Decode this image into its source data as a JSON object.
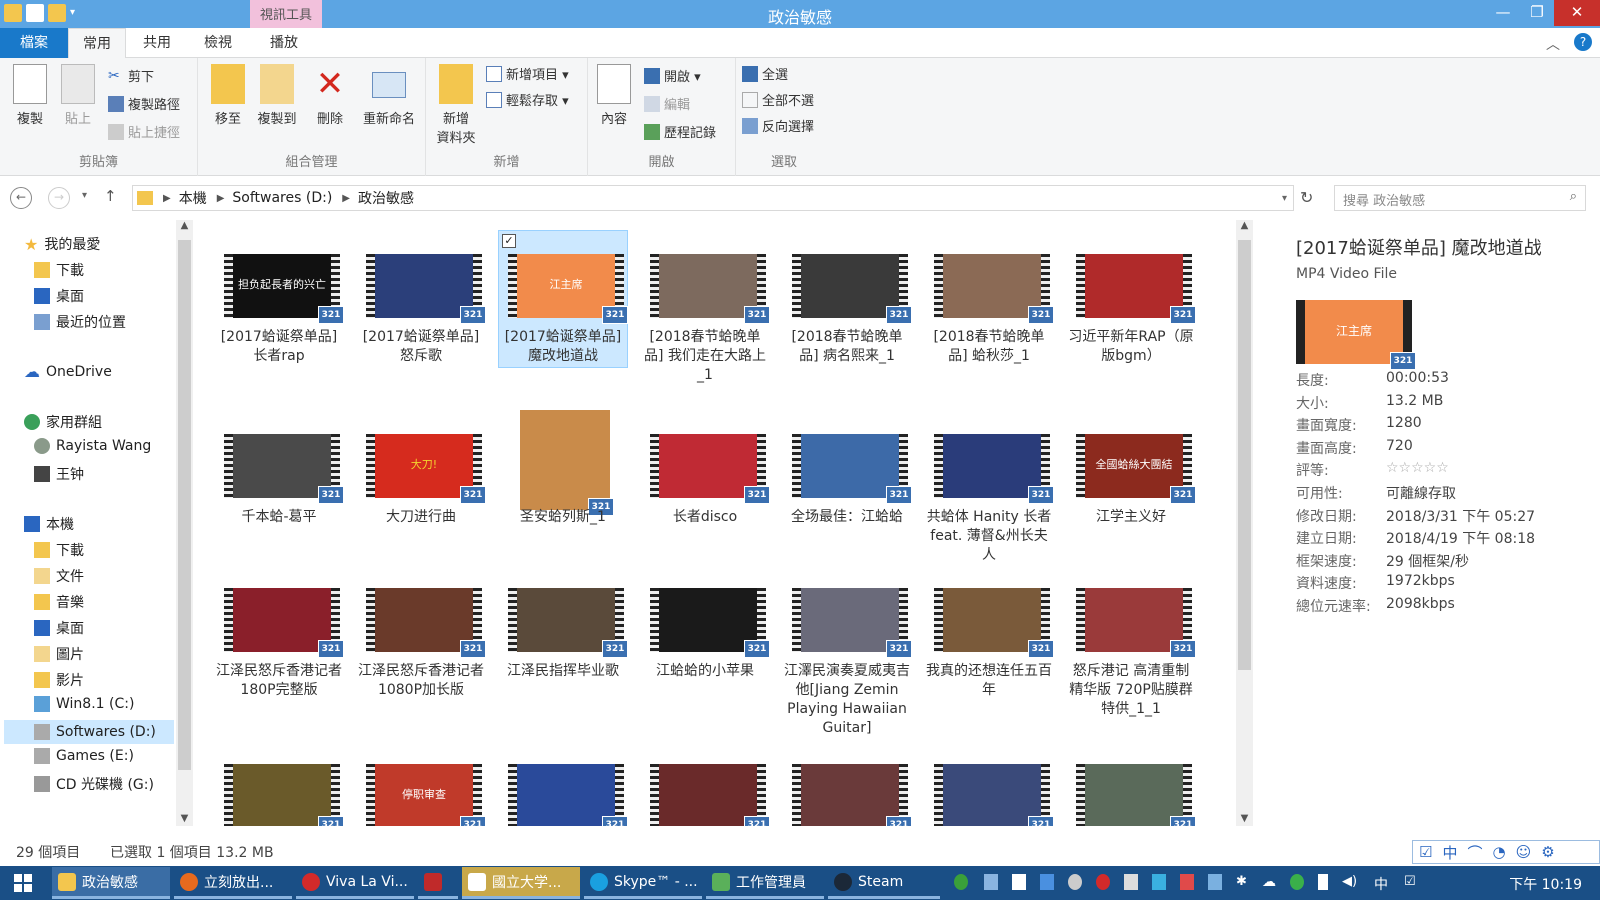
{
  "window": {
    "title": "政治敏感",
    "context_tab": "視訊工具",
    "buttons": {
      "minimize": "—",
      "maximize": "❐",
      "close": "✕"
    }
  },
  "ribbon_tabs": [
    "檔案",
    "常用",
    "共用",
    "檢視",
    "播放"
  ],
  "ribbon": {
    "clipboard": {
      "copy": "複製",
      "paste": "貼上",
      "cut": "剪下",
      "copy_path": "複製路徑",
      "paste_shortcut": "貼上捷徑",
      "group": "剪貼簿"
    },
    "organize": {
      "move_to": "移至",
      "copy_to": "複製到",
      "delete": "刪除",
      "rename": "重新命名",
      "group": "組合管理"
    },
    "new": {
      "new_folder_line1": "新增",
      "new_folder_line2": "資料夾",
      "new_item": "新增項目 ▾",
      "easy_access": "輕鬆存取 ▾",
      "group": "新增"
    },
    "open": {
      "properties": "內容",
      "open": "開啟 ▾",
      "edit": "編輯",
      "history": "歷程記錄",
      "group": "開啟"
    },
    "select": {
      "select_all": "全選",
      "select_none": "全部不選",
      "invert": "反向選擇",
      "group": "選取"
    }
  },
  "address": {
    "crumbs": [
      "本機",
      "Softwares (D:)",
      "政治敏感"
    ],
    "search_placeholder": "搜尋 政治敏感"
  },
  "nav": {
    "favorites": "我的最愛",
    "downloads": "下載",
    "desktop": "桌面",
    "recent": "最近的位置",
    "onedrive": "OneDrive",
    "homegroup": "家用群組",
    "user1": "Rayista Wang",
    "user2": "王钟",
    "thispc": "本機",
    "pc_items": [
      "下載",
      "文件",
      "音樂",
      "桌面",
      "圖片",
      "影片",
      "Win8.1 (C:)",
      "Softwares (D:)",
      "Games (E:)",
      "CD 光碟機 (G:)"
    ]
  },
  "files": [
    {
      "label": "[2017蛤诞祭单品] 长者rap",
      "color": "#111111",
      "text": "担负起長者的兴亡"
    },
    {
      "label": "[2017蛤诞祭单品] 怒斥歌",
      "color": "#2b3f7a",
      "text": ""
    },
    {
      "label": "[2017蛤诞祭单品] 魔改地道战",
      "color": "#f28b4b",
      "text": "江主席"
    },
    {
      "label": "[2018春节蛤晚单品] 我们走在大路上_1",
      "color": "#7d6a5e",
      "text": ""
    },
    {
      "label": "[2018春节蛤晚单品] 病名熙来_1",
      "color": "#3a3a3a",
      "text": ""
    },
    {
      "label": "[2018春节蛤晚单品] 蛤秋莎_1",
      "color": "#8b6a55",
      "text": ""
    },
    {
      "label": "习近平新年RAP（原版bgm）",
      "color": "#b02a2a",
      "text": ""
    },
    {
      "label": "千本蛤-葛平",
      "color": "#4a4a4a",
      "text": ""
    },
    {
      "label": "大刀进行曲",
      "color": "#d62b1e",
      "text": "大刀!"
    },
    {
      "label": "圣安蛤列斯_1",
      "color": "#c98b4a",
      "text": ""
    },
    {
      "label": "长者disco",
      "color": "#c02a34",
      "text": ""
    },
    {
      "label": "全场最佳：江蛤蛤",
      "color": "#3d6aa8",
      "text": ""
    },
    {
      "label": "共蛤体 Hanity 长者 feat. 薄督&州长夫人",
      "color": "#2a3c7a",
      "text": ""
    },
    {
      "label": "江学主义好",
      "color": "#8c2a1e",
      "text": "全國蛤絲大團結"
    },
    {
      "label": "江泽民怒斥香港记者180P完整版",
      "color": "#8a1f2a",
      "text": ""
    },
    {
      "label": "江泽民怒斥香港记者1080P加长版",
      "color": "#6a3a2a",
      "text": ""
    },
    {
      "label": "江泽民指挥毕业歌",
      "color": "#5a4a3a",
      "text": ""
    },
    {
      "label": "江蛤蛤的小苹果",
      "color": "#1a1a1a",
      "text": ""
    },
    {
      "label": "江澤民演奏夏威夷吉他[Jiang Zemin Playing Hawaiian Guitar]",
      "color": "#6a6a7a",
      "text": ""
    },
    {
      "label": "我真的还想连任五百年",
      "color": "#7a5a3a",
      "text": ""
    },
    {
      "label": "怒斥港记 高清重制精华版 720P贴膜群特供_1_1",
      "color": "#9a3a3a",
      "text": ""
    },
    {
      "label": "",
      "color": "#6a5a2a",
      "text": ""
    },
    {
      "label": "",
      "color": "#c03a2a",
      "text": "停职审查"
    },
    {
      "label": "",
      "color": "#2a4a9a",
      "text": ""
    },
    {
      "label": "",
      "color": "#6a2a2a",
      "text": ""
    },
    {
      "label": "",
      "color": "#6a3a3a",
      "text": ""
    },
    {
      "label": "",
      "color": "#3a4a7a",
      "text": ""
    },
    {
      "label": "",
      "color": "#5a6a5a",
      "text": ""
    }
  ],
  "details": {
    "title": "[2017蛤诞祭单品] 魔改地道战",
    "type": "MP4 Video File",
    "thumb_text": "江主席",
    "rows": [
      {
        "k": "長度:",
        "v": "00:00:53"
      },
      {
        "k": "大小:",
        "v": "13.2 MB"
      },
      {
        "k": "畫面寬度:",
        "v": "1280"
      },
      {
        "k": "畫面高度:",
        "v": "720"
      },
      {
        "k": "評等:",
        "v": "☆☆☆☆☆"
      },
      {
        "k": "可用性:",
        "v": "可離線存取"
      },
      {
        "k": "修改日期:",
        "v": "2018/3/31 下午 05:27"
      },
      {
        "k": "建立日期:",
        "v": "2018/4/19 下午 08:18"
      },
      {
        "k": "框架速度:",
        "v": "29 個框架/秒"
      },
      {
        "k": "資料速度:",
        "v": "1972kbps"
      },
      {
        "k": "總位元速率:",
        "v": "2098kbps"
      }
    ]
  },
  "status": {
    "count": "29 個項目",
    "selected": "已選取 1 個項目  13.2 MB"
  },
  "taskbar": {
    "items": [
      "政治敏感",
      "立刻放出...",
      "Viva La Vi...",
      "",
      "國立大学...",
      "Skype™ - ...",
      "工作管理員",
      "Steam"
    ],
    "ime": [
      "中",
      "⌒",
      "◔",
      "☺"
    ],
    "input_lang": "中",
    "clock": "下午 10:19"
  },
  "colors": {
    "accent": "#1979ca",
    "titlebar": "#5ca5e3",
    "taskbar": "#1a4f86",
    "close": "#c7302b",
    "select": "#cce8ff"
  }
}
